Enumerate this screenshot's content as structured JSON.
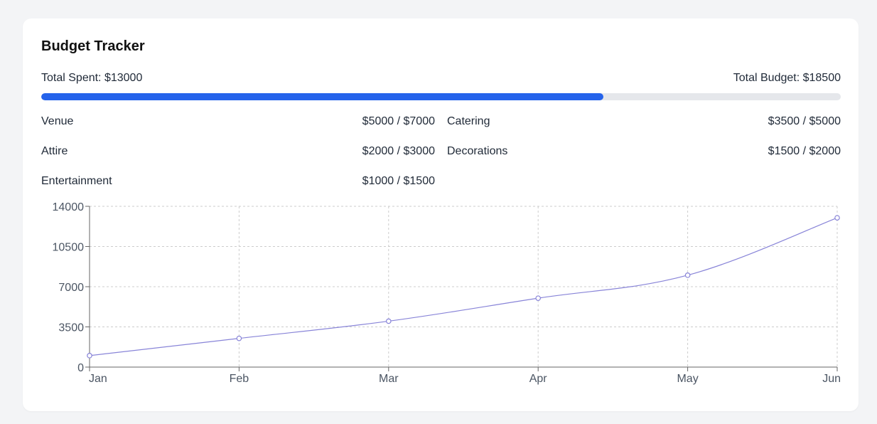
{
  "card": {
    "title": "Budget Tracker",
    "total_spent_label": "Total Spent: $13000",
    "total_budget_label": "Total Budget: $18500",
    "progress_fraction": 0.7027
  },
  "categories": [
    {
      "name": "Venue",
      "amount": "$5000 / $7000"
    },
    {
      "name": "Catering",
      "amount": "$3500 / $5000"
    },
    {
      "name": "Attire",
      "amount": "$2000 / $3000"
    },
    {
      "name": "Decorations",
      "amount": "$1500 / $2000"
    },
    {
      "name": "Entertainment",
      "amount": "$1000 / $1500"
    }
  ],
  "colors": {
    "progress": "#2563eb",
    "progress_track": "#e5e7eb",
    "line": "#8884d8",
    "grid": "#cccccc"
  },
  "chart_data": {
    "type": "line",
    "categories": [
      "Jan",
      "Feb",
      "Mar",
      "Apr",
      "May",
      "Jun"
    ],
    "values": [
      1000,
      2500,
      4000,
      6000,
      8000,
      13000
    ],
    "y_ticks": [
      "0",
      "3500",
      "7000",
      "10500",
      "14000"
    ],
    "ylim": [
      0,
      14000
    ],
    "grid": true,
    "title": "",
    "xlabel": "",
    "ylabel": ""
  }
}
